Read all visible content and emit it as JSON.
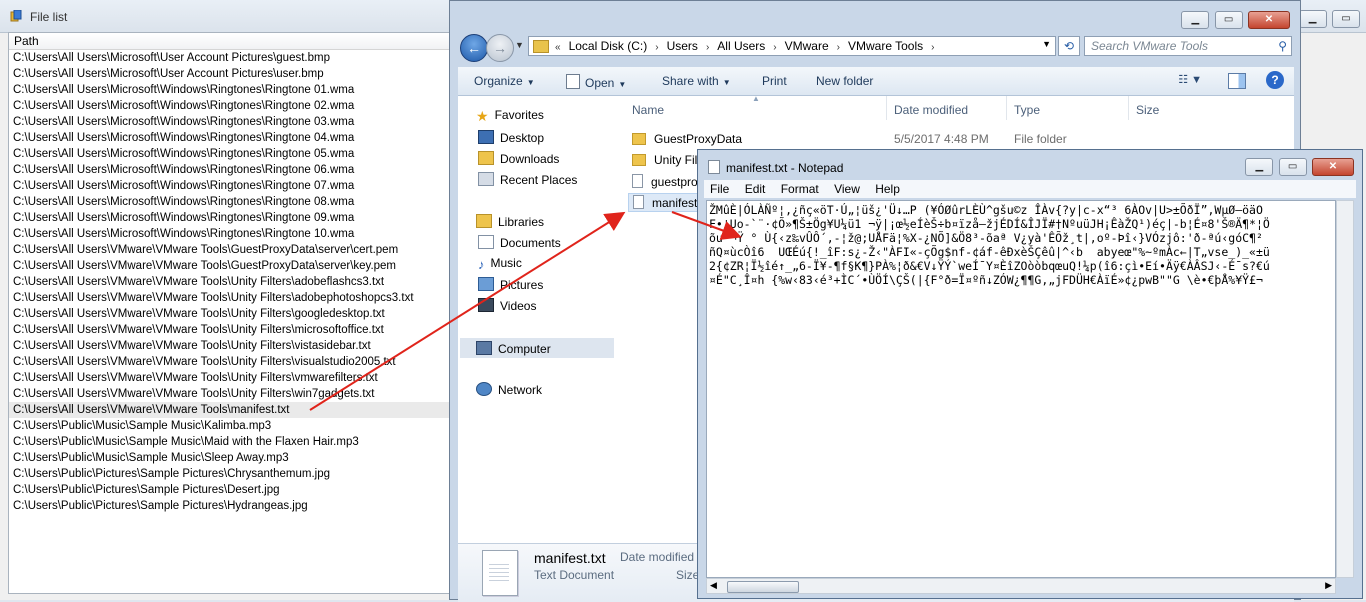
{
  "file_list": {
    "title": "File list",
    "column_header": "Path",
    "selected_index": 22,
    "rows": [
      "C:\\Users\\All Users\\Microsoft\\User Account Pictures\\guest.bmp",
      "C:\\Users\\All Users\\Microsoft\\User Account Pictures\\user.bmp",
      "C:\\Users\\All Users\\Microsoft\\Windows\\Ringtones\\Ringtone 01.wma",
      "C:\\Users\\All Users\\Microsoft\\Windows\\Ringtones\\Ringtone 02.wma",
      "C:\\Users\\All Users\\Microsoft\\Windows\\Ringtones\\Ringtone 03.wma",
      "C:\\Users\\All Users\\Microsoft\\Windows\\Ringtones\\Ringtone 04.wma",
      "C:\\Users\\All Users\\Microsoft\\Windows\\Ringtones\\Ringtone 05.wma",
      "C:\\Users\\All Users\\Microsoft\\Windows\\Ringtones\\Ringtone 06.wma",
      "C:\\Users\\All Users\\Microsoft\\Windows\\Ringtones\\Ringtone 07.wma",
      "C:\\Users\\All Users\\Microsoft\\Windows\\Ringtones\\Ringtone 08.wma",
      "C:\\Users\\All Users\\Microsoft\\Windows\\Ringtones\\Ringtone 09.wma",
      "C:\\Users\\All Users\\Microsoft\\Windows\\Ringtones\\Ringtone 10.wma",
      "C:\\Users\\All Users\\VMware\\VMware Tools\\GuestProxyData\\server\\cert.pem",
      "C:\\Users\\All Users\\VMware\\VMware Tools\\GuestProxyData\\server\\key.pem",
      "C:\\Users\\All Users\\VMware\\VMware Tools\\Unity Filters\\adobeflashcs3.txt",
      "C:\\Users\\All Users\\VMware\\VMware Tools\\Unity Filters\\adobephotoshopcs3.txt",
      "C:\\Users\\All Users\\VMware\\VMware Tools\\Unity Filters\\googledesktop.txt",
      "C:\\Users\\All Users\\VMware\\VMware Tools\\Unity Filters\\microsoftoffice.txt",
      "C:\\Users\\All Users\\VMware\\VMware Tools\\Unity Filters\\vistasidebar.txt",
      "C:\\Users\\All Users\\VMware\\VMware Tools\\Unity Filters\\visualstudio2005.txt",
      "C:\\Users\\All Users\\VMware\\VMware Tools\\Unity Filters\\vmwarefilters.txt",
      "C:\\Users\\All Users\\VMware\\VMware Tools\\Unity Filters\\win7gadgets.txt",
      "C:\\Users\\All Users\\VMware\\VMware Tools\\manifest.txt",
      "C:\\Users\\Public\\Music\\Sample Music\\Kalimba.mp3",
      "C:\\Users\\Public\\Music\\Sample Music\\Maid with the Flaxen Hair.mp3",
      "C:\\Users\\Public\\Music\\Sample Music\\Sleep Away.mp3",
      "C:\\Users\\Public\\Pictures\\Sample Pictures\\Chrysanthemum.jpg",
      "C:\\Users\\Public\\Pictures\\Sample Pictures\\Desert.jpg",
      "C:\\Users\\Public\\Pictures\\Sample Pictures\\Hydrangeas.jpg"
    ]
  },
  "explorer": {
    "address": {
      "overflow": "«",
      "segments": [
        "Local Disk (C:)",
        "Users",
        "All Users",
        "VMware",
        "VMware Tools"
      ]
    },
    "search_placeholder": "Search VMware Tools",
    "toolbar": {
      "organize": "Organize",
      "open": "Open",
      "share_with": "Share with",
      "print": "Print",
      "new_folder": "New folder"
    },
    "nav": {
      "favorites": "Favorites",
      "desktop": "Desktop",
      "downloads": "Downloads",
      "recent_places": "Recent Places",
      "libraries": "Libraries",
      "documents": "Documents",
      "music": "Music",
      "pictures": "Pictures",
      "videos": "Videos",
      "computer": "Computer",
      "network": "Network"
    },
    "columns": {
      "name": "Name",
      "date_modified": "Date modified",
      "type": "Type",
      "size": "Size"
    },
    "files": [
      {
        "name": "GuestProxyData",
        "date": "5/5/2017 4:48 PM",
        "type": "File folder",
        "kind": "folder"
      },
      {
        "name": "Unity Fil",
        "date": "",
        "type": "",
        "kind": "folder"
      },
      {
        "name": "guestpro",
        "date": "",
        "type": "",
        "kind": "doc"
      },
      {
        "name": "manifest",
        "date": "",
        "type": "",
        "kind": "doc"
      }
    ],
    "details": {
      "name": "manifest.txt",
      "type": "Text Document",
      "date_label": "Date modified",
      "size_label": "Size"
    }
  },
  "notepad": {
    "title": "manifest.txt - Notepad",
    "menu": [
      "File",
      "Edit",
      "Format",
      "View",
      "Help"
    ],
    "lines": [
      "ŽMûÈ|ÓLÀÑº¦,¿ñç«öT·Ú„¦üš¿'Ü↓…P (¥ÓØûrLÈÙ^gšu©z ÎÀv{?y|c-x“³ 6ÀOv|U>±ÕðÏ”,WµØ–öäO",
      "F•¦Uo-`¨·¢Õ»¶Š±Ög¥U¼ü1 ¬ÿ|¡œ½eÍèŠ÷b¤ïzå–žjÉDÍ&ÎJÏ#†NºuüJH¡ÊàŽQ¹)éç|-b¦É¤8'Š®Ä¶*¦Ö",
      "õu ¬Ÿ ° Ù{‹z‰vÛÔ´,-¦ž@;UÅFä¦%X-¿NÕ]&Ö8³-õaª V¿yà'ÊÕž¸t|,oº-Þî‹}VÓzjô:'ð-ªú‹góC¶²",
      "ñQ¤ùcÒî6  UŒÉú{!_îF:s¿-Ž‹\"ÀFI«-çÕg$nf-¢áf-êÐxèŠÇêû|^‹b  abyeœ\"%~ºmÀc←|T„vse_)_«±ü",
      "2{¢ZR¦Ï½îé↑_„6-Ï¥-¶f§K¶}PÀ%¦ð&€V↓ŸÝ`weÍ¯Y¤ÈîZOòòbqœuQ!¼p(î6:çì•Eí•Äÿ€ÀÂSJ‹-É¯s?€ú",
      "¤É\"C¸Î¤h {%w‹83‹é³+ÌC´•ÙÖÍ\\ÇŠ(|{F°ð=Ï¤ºñ↓ZÓW¿¶¶G,„jFDÜH€ÀïÉ»¢¿pwB\"\"G \\è•€þÅ%¥Ÿ£¬"
    ]
  }
}
